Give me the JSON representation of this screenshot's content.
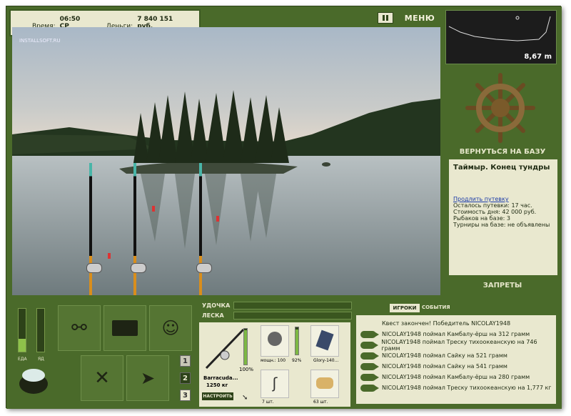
{
  "hud": {
    "time_label": "Время:",
    "time_value": "06:50 СР",
    "money_label": "Деньги:",
    "money_value": "7 840 151 руб."
  },
  "watermark": "INSTALLSOFT.RU",
  "topbar": {
    "pause_icon": "pause-icon",
    "menu_label": "МЕНЮ"
  },
  "depth": {
    "value": "8,67 m"
  },
  "base": {
    "return_label": "ВЕРНУТЬСЯ НА БАЗУ"
  },
  "location": {
    "title": "Таймыр. Конец тундры",
    "extend_link": "Продлить путевку",
    "left": "Осталось путевки: 17 час.",
    "cost": "Стоимость дня: 42 000 руб.",
    "fishers": "Рыбаков на базе: 3",
    "tournaments": "Турниры на базе: не объявлены"
  },
  "bans_label": "ЗАПРЕТЫ",
  "meters": {
    "food_label": "ЕДА",
    "poison_label": "ЯД",
    "food_level": 0.3,
    "poison_level": 0.0
  },
  "rod": {
    "label": "УДОЧКА",
    "line_label": "ЛЕСКА",
    "name": "Barracuda...",
    "weight": "1250 кг",
    "percent": "100%",
    "setup": "НАСТРОИТЬ"
  },
  "gear": {
    "reel_caption": "мощн.: 100",
    "reel_percent": "92%",
    "lure_caption": "Glory-140...",
    "hook_caption": "7 шт.",
    "bait_caption": "63 шт."
  },
  "pages": [
    "1",
    "2",
    "3"
  ],
  "tabs": {
    "players": "ИГРОКИ",
    "events": "СОБЫТИЯ"
  },
  "log": [
    "Квест закончен! Победитель NICOLAY1948",
    "NICOLAY1948 поймал Камбалу-ёрш на 312 грамм",
    "NICOLAY1948 поймал Треску тихоокеанскую на 746 грамм",
    "NICOLAY1948 поймал Сайку на 521 грамм",
    "NICOLAY1948 поймал Сайку на 541 грамм",
    "NICOLAY1948 поймал Камбалу-ёрш на 280 грамм",
    "NICOLAY1948 поймал Треску тихоокеанскую на 1,777 кг"
  ],
  "icons": [
    "rod-icon",
    "tackle-box-icon",
    "angler-icon",
    "utensils-icon",
    "fish-icon",
    "food-pot-icon",
    "helm-icon"
  ]
}
